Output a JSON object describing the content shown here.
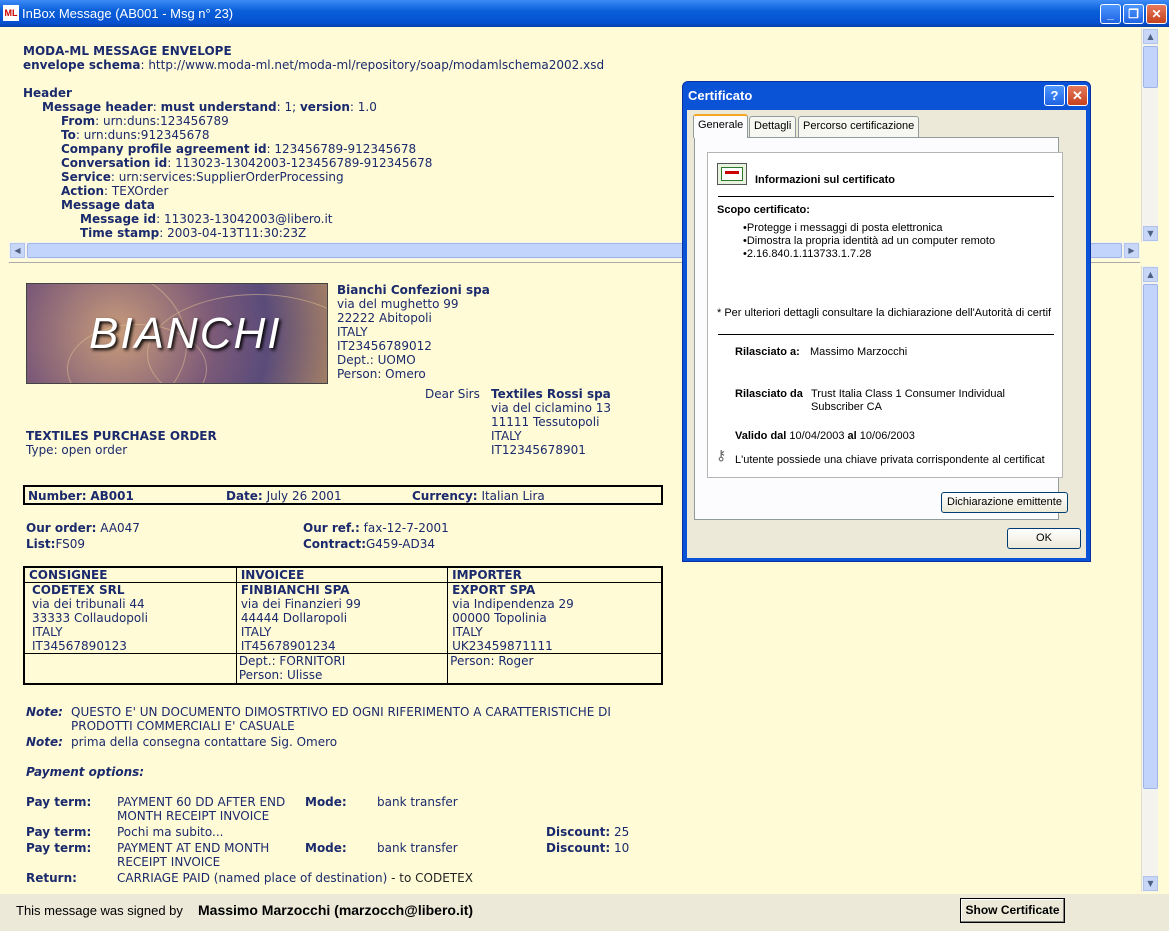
{
  "window": {
    "title": "InBox Message (AB001 -  Msg n°  23)",
    "icon_text": "ML"
  },
  "envelope": {
    "heading": "MODA-ML MESSAGE ENVELOPE",
    "schema_label": "envelope schema",
    "schema_value": "http://www.moda-ml.net/moda-ml/repository/soap/modamlschema2002.xsd",
    "header": "Header",
    "message_header_label": "Message header",
    "must_understand_label": "must understand",
    "must_understand_value": "1;",
    "version_label": "version",
    "version_value": "1.0",
    "fields": [
      {
        "label": "From",
        "value": "urn:duns:123456789"
      },
      {
        "label": "To",
        "value": "urn:duns:912345678"
      },
      {
        "label": "Company profile agreement id",
        "value": "123456789-912345678"
      },
      {
        "label": "Conversation id",
        "value": "113023-13042003-123456789-912345678"
      },
      {
        "label": "Service",
        "value": "urn:services:SupplierOrderProcessing"
      },
      {
        "label": "Action",
        "value": "TEXOrder"
      }
    ],
    "message_data_label": "Message data",
    "message_id_label": "Message id",
    "message_id_value": "113023-13042003@libero.it",
    "timestamp_label": "Time stamp",
    "timestamp_value": "2003-04-13T11:30:23Z"
  },
  "order": {
    "logo_text": "BIANCHI",
    "sender": [
      "Bianchi Confezioni spa",
      "via del mughetto 99",
      "22222 Abitopoli",
      "ITALY",
      "IT23456789012",
      "Dept.: UOMO",
      "Person: Omero"
    ],
    "dear": "Dear Sirs",
    "recipient": [
      "Textiles Rossi spa",
      "via del ciclamino 13",
      "11111 Tessutopoli",
      "ITALY",
      "IT12345678901"
    ],
    "title": "TEXTILES PURCHASE ORDER",
    "type": "Type: open order",
    "number_label": "Number:",
    "number_value": "AB001",
    "date_label": "Date:",
    "date_value": "July 26 2001",
    "currency_label": "Currency:",
    "currency_value": "Italian Lira",
    "our_order_label": "Our order:",
    "our_order_value": "AA047",
    "our_ref_label": "Our ref.:",
    "our_ref_value": "fax-12-7-2001",
    "list_label": "List:",
    "list_value": "FS09",
    "contract_label": "Contract:",
    "contract_value": "G459-AD34",
    "parties_headers": [
      "CONSIGNEE",
      "INVOICEE",
      "IMPORTER"
    ],
    "parties": [
      {
        "name": "CODETEX SRL",
        "lines": [
          "via dei tribunali 44",
          "33333 Collaudopoli",
          "ITALY",
          "IT34567890123"
        ],
        "extra": [
          "",
          ""
        ]
      },
      {
        "name": "FINBIANCHI SPA",
        "lines": [
          "via dei Finanzieri 99",
          "44444 Dollaropoli",
          "ITALY",
          "IT45678901234"
        ],
        "extra": [
          "Dept.: FORNITORI",
          "Person: Ulisse"
        ]
      },
      {
        "name": "EXPORT SPA",
        "lines": [
          "via Indipendenza 29",
          "00000 Topolinia",
          "ITALY",
          "UK23459871111"
        ],
        "extra": [
          "Person: Roger",
          ""
        ]
      }
    ],
    "note_label": "Note:",
    "note1_line1": "QUESTO E' UN DOCUMENTO DIMOSTRTIVO ED OGNI RIFERIMENTO A CARATTERISTICHE DI",
    "note1_line2": "PRODOTTI COMMERCIALI E' CASUALE",
    "note2": "prima della consegna contattare Sig. Omero",
    "payment_options": "Payment options:",
    "pay_term_label": "Pay term:",
    "mode_label": "Mode:",
    "discount_label": "Discount:",
    "return_label": "Return:",
    "pay1_line1": "PAYMENT 60 DD AFTER END",
    "pay1_line2": "MONTH RECEIPT INVOICE",
    "pay1_mode": "bank transfer",
    "pay2": "Pochi ma subito...",
    "pay2_discount": "25",
    "pay3_line1": "PAYMENT AT END MONTH",
    "pay3_line2": "RECEIPT INVOICE",
    "pay3_mode": "bank transfer",
    "pay3_discount": "10",
    "return_value": "CARRIAGE PAID (named place of destination)",
    "return_suffix": " - to CODETEX"
  },
  "status": {
    "signed_label": "This message was signed by",
    "signer": "Massimo Marzocchi (marzocch@libero.it)",
    "show_cert": "Show Certificate"
  },
  "dialog": {
    "title": "Certificato",
    "tabs": [
      "Generale",
      "Dettagli",
      "Percorso certificazione"
    ],
    "info_title": "Informazioni sul certificato",
    "scope_label": "Scopo certificato:",
    "purposes": [
      "•Protegge i messaggi di posta elettronica",
      "•Dimostra la propria identità ad un computer remoto",
      "•2.16.840.1.113733.1.7.28"
    ],
    "footnote": "* Per ulteriori dettagli consultare la dichiarazione dell'Autorità di certif",
    "issued_to_label": "Rilasciato a:",
    "issued_to": "Massimo Marzocchi",
    "issued_by_label": "Rilasciato da",
    "issued_by_line1": "Trust Italia Class 1 Consumer Individual",
    "issued_by_line2": "Subscriber CA",
    "valid_label": "Valido dal",
    "valid_from": "10/04/2003",
    "valid_to_label": "al",
    "valid_to": "10/06/2003",
    "private_key": "L'utente possiede una chiave privata corrispondente al certificat",
    "issuer_statement_button": "Dichiarazione emittente",
    "ok_button": "OK"
  }
}
